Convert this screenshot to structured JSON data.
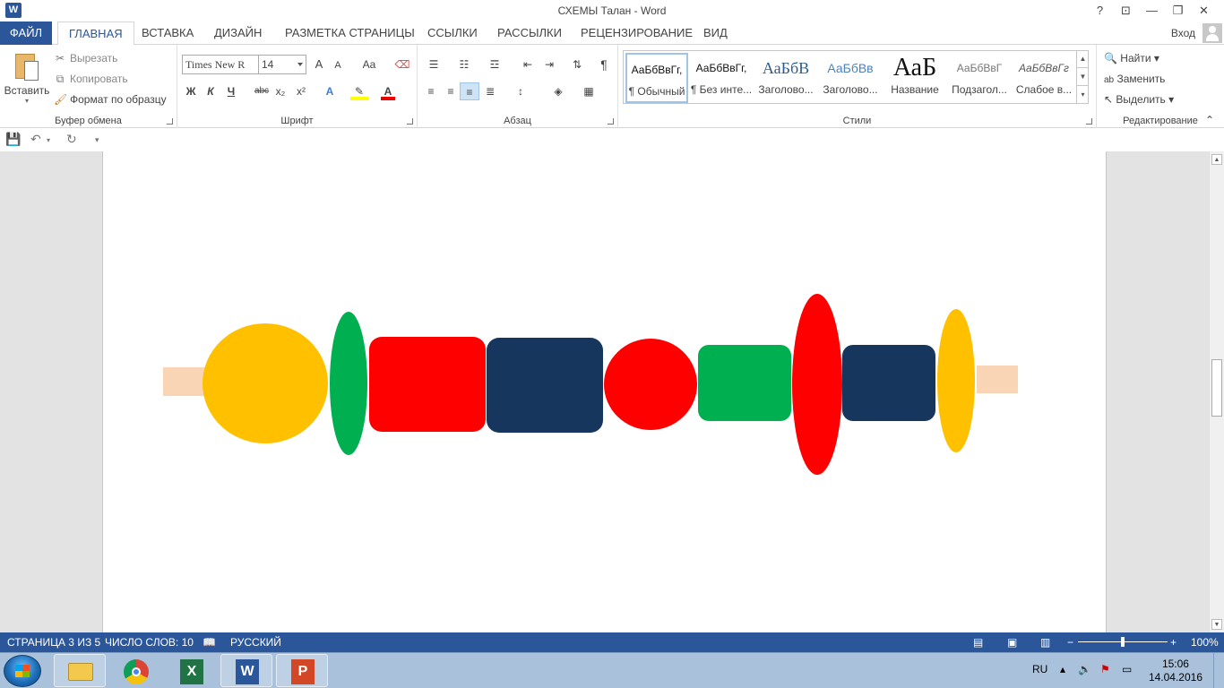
{
  "window": {
    "app_icon": "W",
    "title": "СХЕМЫ Талан - Word",
    "help": "?",
    "restore_ribbon": "⊡",
    "minimize": "—",
    "maximize": "❐",
    "close": "✕"
  },
  "tabs": {
    "file": "ФАЙЛ",
    "items": [
      "ГЛАВНАЯ",
      "ВСТАВКА",
      "ДИЗАЙН",
      "РАЗМЕТКА СТРАНИЦЫ",
      "ССЫЛКИ",
      "РАССЫЛКИ",
      "РЕЦЕНЗИРОВАНИЕ",
      "ВИД"
    ],
    "login": "Вход"
  },
  "clipboard": {
    "paste": "Вставить",
    "cut": "Вырезать",
    "copy": "Копировать",
    "format_painter": "Формат по образцу",
    "label": "Буфер обмена"
  },
  "font": {
    "name": "Times New R",
    "size": "14",
    "grow": "A",
    "shrink": "A",
    "case": "Aa",
    "bold": "Ж",
    "italic": "К",
    "underline": "Ч",
    "strike": "abc",
    "subscript": "x₂",
    "superscript": "x²",
    "label": "Шрифт"
  },
  "paragraph": {
    "pilcrow": "¶",
    "label": "Абзац"
  },
  "styles": {
    "items": [
      {
        "preview": "АаБбВвГг,",
        "name": "¶ Обычный"
      },
      {
        "preview": "АаБбВвГг,",
        "name": "¶ Без инте..."
      },
      {
        "preview": "АаБбВ",
        "name": "Заголово..."
      },
      {
        "preview": "АаБбВв",
        "name": "Заголово..."
      },
      {
        "preview": "АаБ",
        "name": "Название"
      },
      {
        "preview": "АаБбВвГ",
        "name": "Подзагол..."
      },
      {
        "preview": "АаБбВвГг",
        "name": "Слабое в..."
      }
    ],
    "label": "Стили"
  },
  "editing": {
    "find": "Найти",
    "replace": "Заменить",
    "select": "Выделить",
    "label": "Редактирование"
  },
  "document": {
    "shapes": [
      {
        "kind": "rect",
        "color": "#f9d5b5"
      },
      {
        "kind": "ellipse",
        "color": "#ffc000"
      },
      {
        "kind": "ellipse",
        "color": "#00b050"
      },
      {
        "kind": "rounded-rect",
        "color": "#ff0000"
      },
      {
        "kind": "rounded-rect",
        "color": "#17365d"
      },
      {
        "kind": "ellipse",
        "color": "#ff0000"
      },
      {
        "kind": "rounded-rect",
        "color": "#00b050"
      },
      {
        "kind": "ellipse",
        "color": "#ff0000"
      },
      {
        "kind": "rounded-rect",
        "color": "#17365d"
      },
      {
        "kind": "ellipse",
        "color": "#ffc000"
      },
      {
        "kind": "rect",
        "color": "#f9d5b5"
      }
    ]
  },
  "status": {
    "page": "СТРАНИЦА 3 ИЗ 5",
    "words": "ЧИСЛО СЛОВ: 10",
    "language": "РУССКИЙ",
    "zoom_minus": "−",
    "zoom_plus": "+",
    "zoom": "100%",
    "zoom_level": 0.5
  },
  "taskbar": {
    "lang": "RU",
    "time": "15:06",
    "date": "14.04.2016"
  },
  "colors": {
    "accent": "#2b579a"
  }
}
